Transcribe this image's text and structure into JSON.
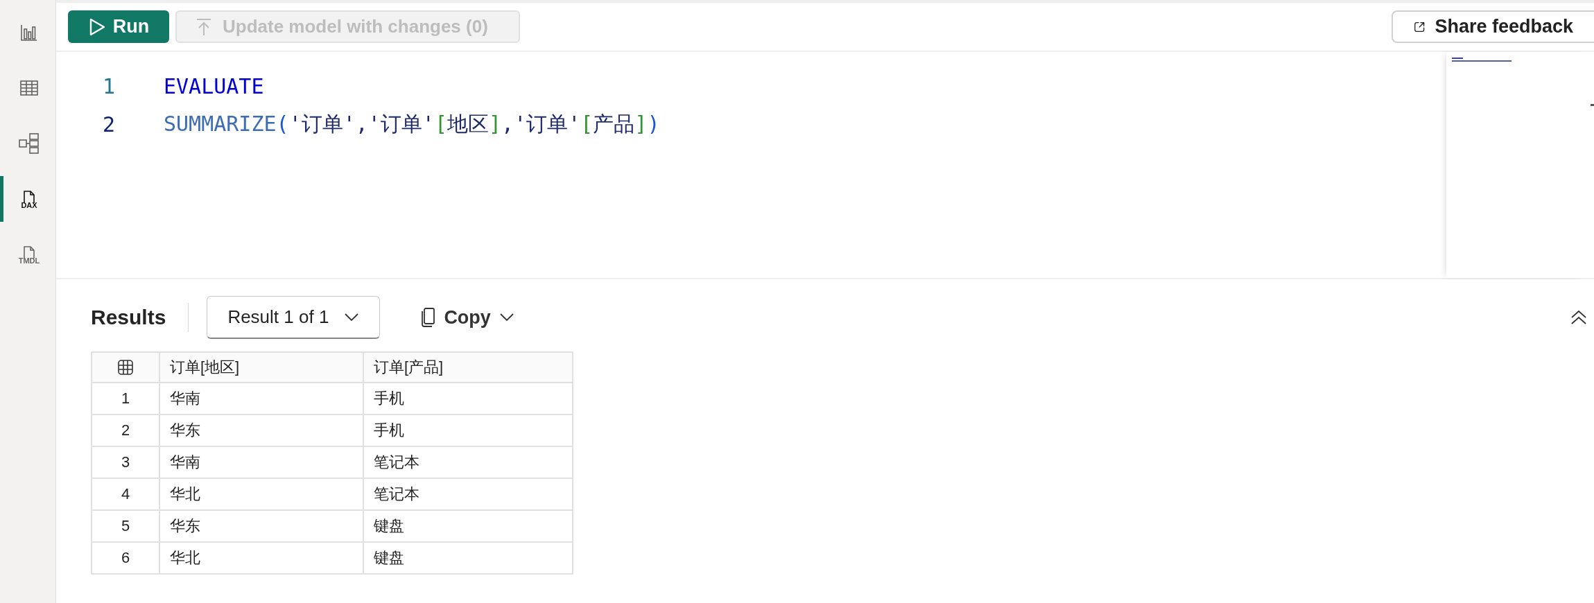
{
  "sidebar": {
    "items": [
      {
        "kind": "chart",
        "selected": false
      },
      {
        "kind": "table",
        "selected": false
      },
      {
        "kind": "model",
        "selected": false
      },
      {
        "kind": "file",
        "label": "DAX",
        "selected": true
      },
      {
        "kind": "file",
        "label": "TMDL",
        "selected": false
      }
    ]
  },
  "toolbar": {
    "run_button": "Run",
    "update_button": {
      "label": "Update model with changes (0)",
      "disabled": true
    },
    "feedback_button": "Share feedback"
  },
  "editor": {
    "lines": [
      {
        "number": "1",
        "current": false,
        "tokens": [
          {
            "kind": "keyword",
            "text": "EVALUATE"
          }
        ]
      },
      {
        "number": "2",
        "current": true,
        "tokens": [
          {
            "kind": "function",
            "text": "SUMMARIZE"
          },
          {
            "kind": "paren",
            "text": "("
          },
          {
            "kind": "string",
            "text": "'订单'"
          },
          {
            "kind": "punct",
            "text": ","
          },
          {
            "kind": "string",
            "text": "'订单'"
          },
          {
            "kind": "bracket",
            "text": "["
          },
          {
            "kind": "name",
            "text": "地区"
          },
          {
            "kind": "bracket",
            "text": "]"
          },
          {
            "kind": "punct",
            "text": ","
          },
          {
            "kind": "string",
            "text": "'订单'"
          },
          {
            "kind": "bracket",
            "text": "["
          },
          {
            "kind": "name",
            "text": "产品"
          },
          {
            "kind": "bracket",
            "text": "]"
          },
          {
            "kind": "paren",
            "text": ")"
          }
        ]
      }
    ]
  },
  "results": {
    "title": "Results",
    "result_selector": "Result 1 of 1",
    "copy_button": "Copy",
    "table": {
      "columns": [
        "订单[地区]",
        "订单[产品]"
      ],
      "rows": [
        {
          "number": "1",
          "cells": [
            "华南",
            "手机"
          ]
        },
        {
          "number": "2",
          "cells": [
            "华东",
            "手机"
          ]
        },
        {
          "number": "3",
          "cells": [
            "华南",
            "笔记本"
          ]
        },
        {
          "number": "4",
          "cells": [
            "华北",
            "笔记本"
          ]
        },
        {
          "number": "5",
          "cells": [
            "华东",
            "键盘"
          ]
        },
        {
          "number": "6",
          "cells": [
            "华北",
            "键盘"
          ]
        }
      ]
    }
  }
}
